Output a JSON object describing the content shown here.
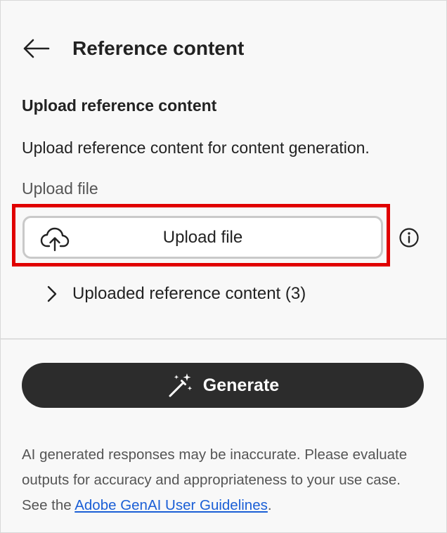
{
  "header": {
    "back_icon": "arrow-left-icon",
    "title": "Reference content"
  },
  "upload_section": {
    "title": "Upload reference content",
    "description": "Upload reference content for content generation.",
    "field_label": "Upload file",
    "upload_button_label": "Upload file",
    "upload_icon": "cloud-upload-icon",
    "info_icon": "info-icon",
    "highlight_color": "#e00000"
  },
  "uploaded": {
    "label": "Uploaded reference content (3)",
    "chevron_icon": "chevron-right-icon"
  },
  "generate": {
    "label": "Generate",
    "icon": "magic-wand-icon",
    "background": "#2c2c2c"
  },
  "disclaimer": {
    "text_before": "AI generated responses may be inaccurate. Please evaluate outputs for accuracy and appropriateness to your use case. See the ",
    "link_text": "Adobe GenAI User Guidelines",
    "text_after": ".",
    "link_color": "#1b5fd6"
  }
}
